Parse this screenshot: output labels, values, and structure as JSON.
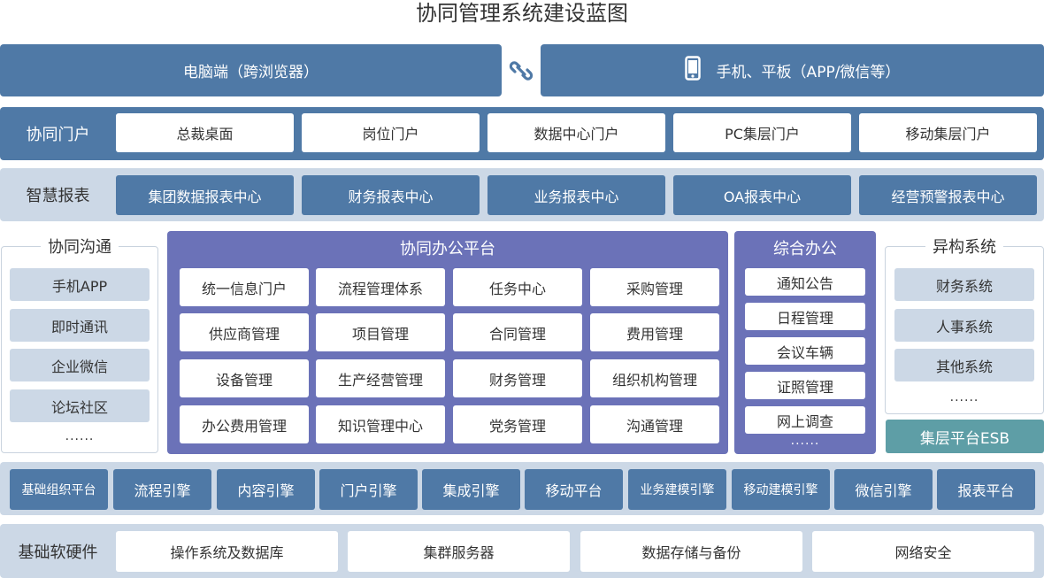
{
  "title": "协同管理系统建设蓝图",
  "endpoints": {
    "pc": "电脑端（跨浏览器）",
    "mobile": "手机、平板（APP/微信等）",
    "link_icon": "link-icon",
    "phone_icon": "phone-icon"
  },
  "portal": {
    "label": "协同门户",
    "items": [
      "总裁桌面",
      "岗位门户",
      "数据中心门户",
      "PC集层门户",
      "移动集层门户"
    ]
  },
  "reports": {
    "label": "智慧报表",
    "items": [
      "集团数据报表中心",
      "财务报表中心",
      "业务报表中心",
      "OA报表中心",
      "经营预警报表中心"
    ]
  },
  "communication": {
    "title": "协同沟通",
    "items": [
      "手机APP",
      "即时通讯",
      "企业微信",
      "论坛社区"
    ],
    "more": "......"
  },
  "office_platform": {
    "title": "协同办公平台",
    "items": [
      "统一信息门户",
      "流程管理体系",
      "任务中心",
      "采购管理",
      "供应商管理",
      "项目管理",
      "合同管理",
      "费用管理",
      "设备管理",
      "生产经营管理",
      "财务管理",
      "组织机构管理",
      "办公费用管理",
      "知识管理中心",
      "党务管理",
      "沟通管理"
    ]
  },
  "general_office": {
    "title": "综合办公",
    "items": [
      "通知公告",
      "日程管理",
      "会议车辆",
      "证照管理",
      "网上调查"
    ],
    "more": "......"
  },
  "heterogeneous": {
    "title": "异构系统",
    "items": [
      "财务系统",
      "人事系统",
      "其他系统"
    ],
    "more": "......",
    "esb": "集层平台ESB"
  },
  "engines": {
    "items": [
      "基础组织平台",
      "流程引擎",
      "内容引擎",
      "门户引擎",
      "集成引擎",
      "移动平台",
      "业务建模引擎",
      "移动建模引擎",
      "微信引擎",
      "报表平台"
    ]
  },
  "infrastructure": {
    "label": "基础软硬件",
    "items": [
      "操作系统及数据库",
      "集群服务器",
      "数据存储与备份",
      "网络安全"
    ]
  },
  "colors": {
    "dark_blue": "#4f79a6",
    "pale_blue": "#ccd8e6",
    "purple": "#6b72b8",
    "teal": "#5e9ea6"
  }
}
